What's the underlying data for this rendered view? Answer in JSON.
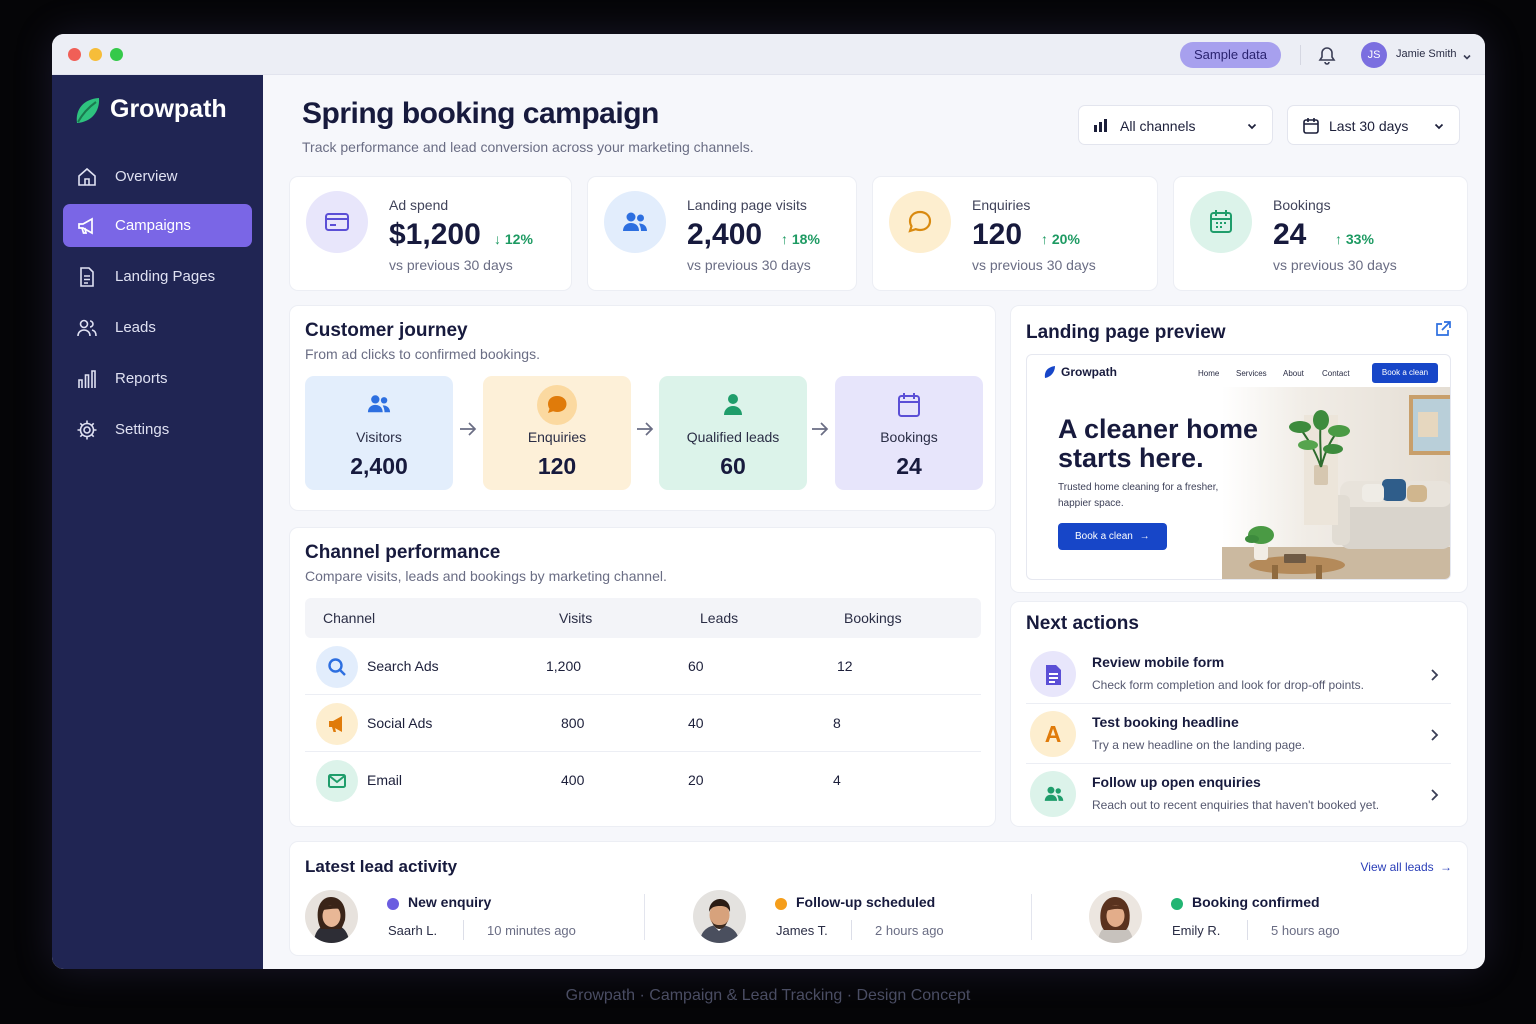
{
  "window": {
    "user_initials": "JS",
    "user_name": "Jamie Smith",
    "sample_data_label": "Sample data"
  },
  "sidebar": {
    "brand": "Growpath",
    "items": [
      {
        "label": "Overview",
        "icon": "home-icon"
      },
      {
        "label": "Campaigns",
        "icon": "megaphone-icon",
        "active": true
      },
      {
        "label": "Landing Pages",
        "icon": "document-icon"
      },
      {
        "label": "Leads",
        "icon": "users-icon"
      },
      {
        "label": "Reports",
        "icon": "bar-chart-icon"
      },
      {
        "label": "Settings",
        "icon": "gear-icon"
      }
    ]
  },
  "header": {
    "title": "Spring booking campaign",
    "subtitle": "Track performance and lead conversion across your marketing channels.",
    "channel_filter": "All channels",
    "date_filter": "Last 30 days"
  },
  "kpis": [
    {
      "label": "Ad spend",
      "value": "$1,200",
      "change": "12%",
      "direction": "down",
      "compare": "vs previous 30 days",
      "icon": "credit-card-icon"
    },
    {
      "label": "Landing page visits",
      "value": "2,400",
      "change": "18%",
      "direction": "up",
      "compare": "vs previous 30 days",
      "icon": "users-icon"
    },
    {
      "label": "Enquiries",
      "value": "120",
      "change": "20%",
      "direction": "up",
      "compare": "vs previous 30 days",
      "icon": "chat-bubble-icon"
    },
    {
      "label": "Bookings",
      "value": "24",
      "change": "33%",
      "direction": "up",
      "compare": "vs previous 30 days",
      "icon": "calendar-icon"
    }
  ],
  "journey": {
    "title": "Customer journey",
    "subtitle": "From ad clicks to confirmed bookings.",
    "stages": [
      {
        "label": "Visitors",
        "value": "2,400",
        "icon": "users-icon"
      },
      {
        "label": "Enquiries",
        "value": "120",
        "icon": "chat-bubble-icon"
      },
      {
        "label": "Qualified leads",
        "value": "60",
        "icon": "person-icon"
      },
      {
        "label": "Bookings",
        "value": "24",
        "icon": "calendar-icon"
      }
    ]
  },
  "channels": {
    "title": "Channel performance",
    "subtitle": "Compare visits, leads and bookings by marketing channel.",
    "columns": [
      "Channel",
      "Visits",
      "Leads",
      "Bookings"
    ],
    "rows": [
      {
        "channel": "Search Ads",
        "visits": "1,200",
        "leads": "60",
        "bookings": "12",
        "icon": "search-icon"
      },
      {
        "channel": "Social Ads",
        "visits": "800",
        "leads": "40",
        "bookings": "8",
        "icon": "megaphone-icon"
      },
      {
        "channel": "Email",
        "visits": "400",
        "leads": "20",
        "bookings": "4",
        "icon": "mail-icon"
      }
    ]
  },
  "preview": {
    "title": "Landing page preview",
    "site_brand": "Growpath",
    "nav": [
      "Home",
      "Services",
      "About",
      "Contact"
    ],
    "nav_button": "Book a clean",
    "headline": "A cleaner home starts here.",
    "subtext": "Trusted home cleaning for a fresher, happier space.",
    "cta": "Book a clean"
  },
  "next_actions": {
    "title": "Next actions",
    "items": [
      {
        "title": "Review mobile form",
        "desc": "Check form completion and look for drop-off points.",
        "icon": "form-icon"
      },
      {
        "title": "Test booking headline",
        "desc": "Try a new headline on the landing page.",
        "icon": "letter-a-icon"
      },
      {
        "title": "Follow up open enquiries",
        "desc": "Reach out to recent enquiries that haven't booked yet.",
        "icon": "users-icon"
      }
    ]
  },
  "activity": {
    "title": "Latest lead activity",
    "view_all": "View all leads",
    "items": [
      {
        "event": "New enquiry",
        "name": "Saarh L.",
        "time": "10 minutes ago",
        "status_color": "#6b5de0"
      },
      {
        "event": "Follow-up scheduled",
        "name": "James T.",
        "time": "2 hours ago",
        "status_color": "#f59e1b"
      },
      {
        "event": "Booking confirmed",
        "name": "Emily R.",
        "time": "5 hours ago",
        "status_color": "#22b573"
      }
    ]
  },
  "caption": "Growpath · Campaign & Lead Tracking · Design Concept"
}
